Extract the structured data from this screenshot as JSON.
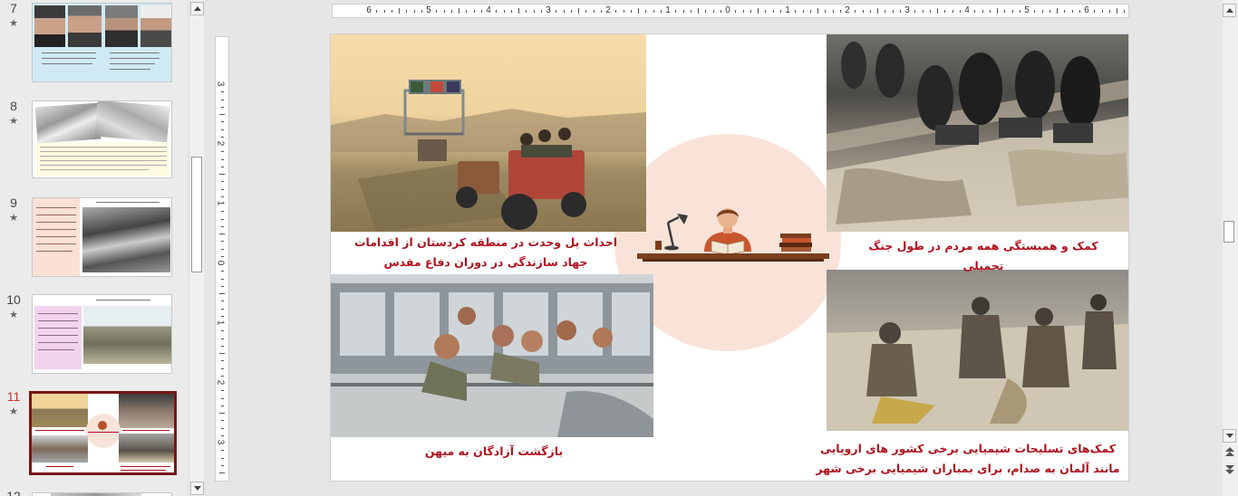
{
  "thumbnails": [
    {
      "number": "7",
      "star": "★",
      "active": false
    },
    {
      "number": "8",
      "star": "★",
      "active": false
    },
    {
      "number": "9",
      "star": "★",
      "active": false
    },
    {
      "number": "10",
      "star": "★",
      "active": false
    },
    {
      "number": "11",
      "star": "★",
      "active": true
    },
    {
      "number": "12",
      "star": "",
      "active": false
    }
  ],
  "ruler": {
    "horizontal_labels": [
      "6",
      "5",
      "4",
      "3",
      "2",
      "1",
      "0",
      "1",
      "2",
      "3",
      "4",
      "5",
      "6"
    ],
    "vertical_labels": [
      "3",
      "2",
      "1",
      "0",
      "1",
      "2",
      "3"
    ]
  },
  "slide": {
    "caption_top_left": "احداث پل وحدت در منطقه کردستان از اقدامات جهاد سازندگی در دوران دفاع مقدس",
    "caption_top_right": "کمک و همبستگی همه مردم در طول جنگ تحمیلی",
    "caption_bottom_left": "بازگشت آزادگان به میهن",
    "caption_bottom_right": "کمک‌های تسلیحات شیمیایی برخی کشور های اروپایی مانند آلمان به صدام، برای بمباران شیمیایی برخی شهر های ایران مانند سردشت",
    "colors": {
      "caption": "#b0131e",
      "circle": "#f9e3d8",
      "active_border": "#7a1515"
    }
  },
  "icons": [
    "star-icon",
    "scroll-up-arrow-icon",
    "scroll-down-arrow-icon",
    "prev-slide-icon",
    "next-slide-icon"
  ]
}
